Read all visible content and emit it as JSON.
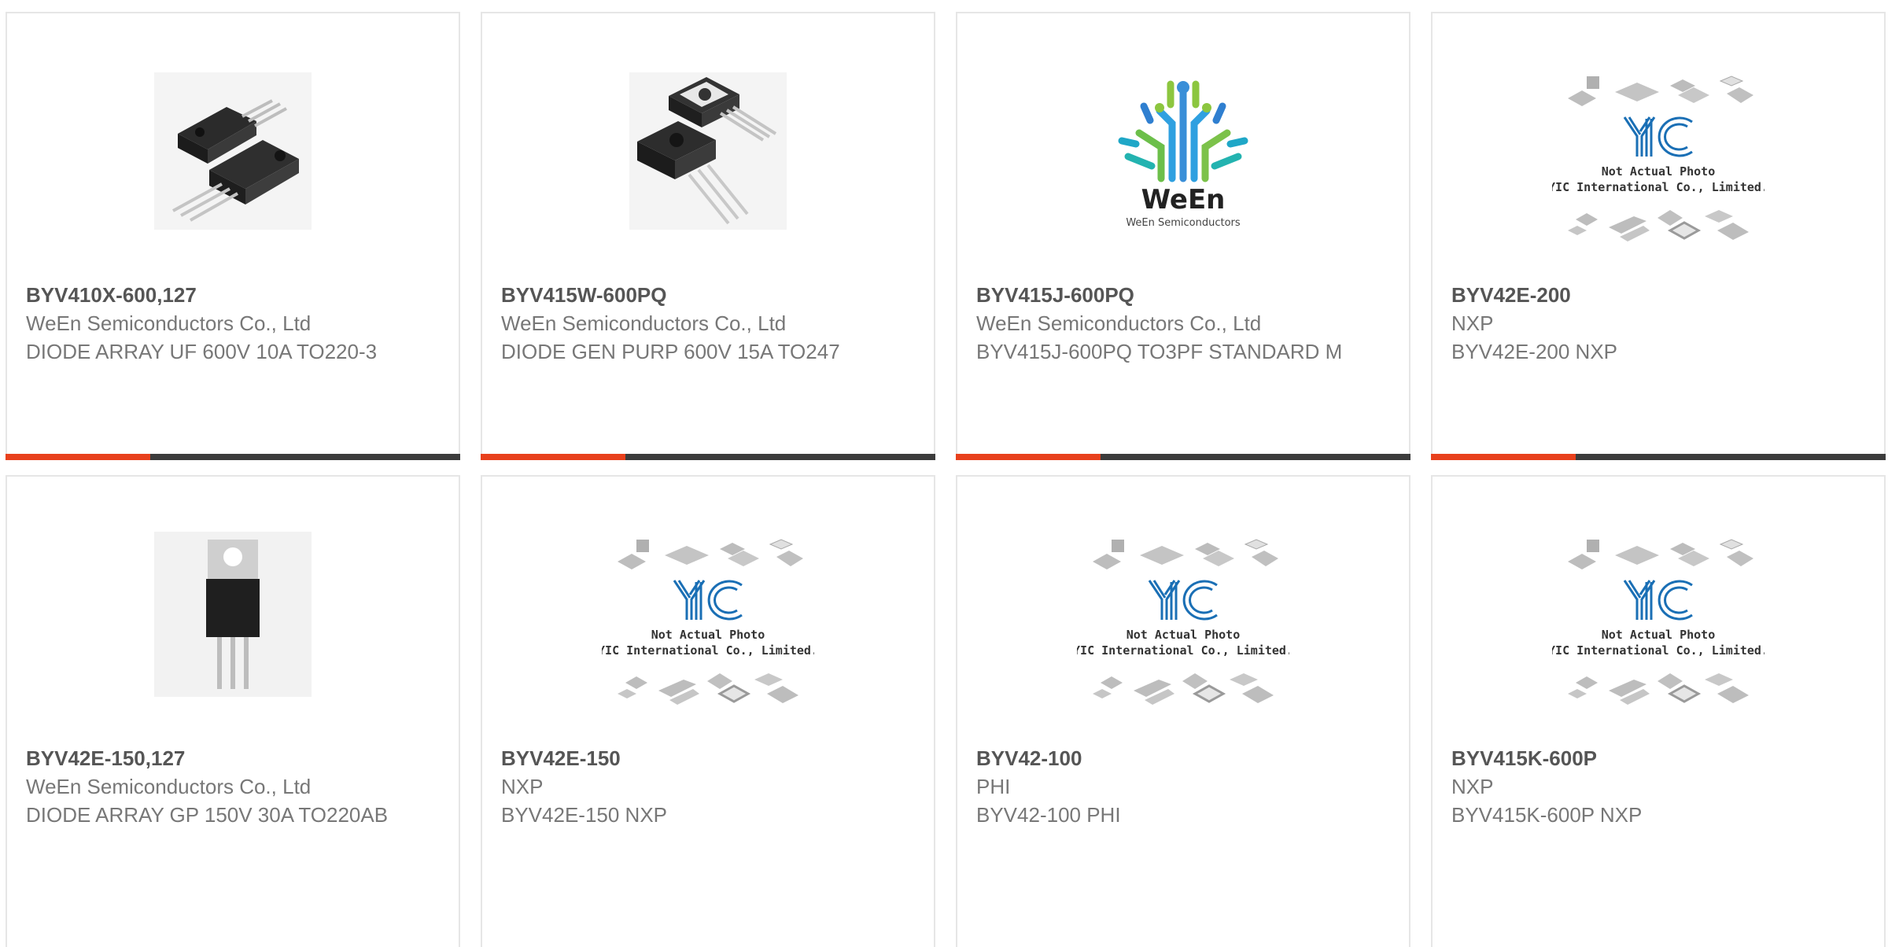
{
  "colors": {
    "accent": "#e8401c",
    "bar": "#3c3c3c",
    "border": "#e6e6e6",
    "title": "#555555",
    "text": "#777777",
    "yic_blue": "#1a6fb5"
  },
  "placeholder": {
    "line1": "Not Actual Photo",
    "line2": "YIC International Co., Limited."
  },
  "ween_logo": {
    "name": "WeEn",
    "sub": "WeEn Semiconductors"
  },
  "products": [
    {
      "part_number": "BYV410X-600,127",
      "manufacturer": "WeEn Semiconductors Co., Ltd",
      "description": "DIODE ARRAY UF 600V 10A TO220-3",
      "image": "to220f-twin-package-photo"
    },
    {
      "part_number": "BYV415W-600PQ",
      "manufacturer": "WeEn Semiconductors Co., Ltd",
      "description": "DIODE GEN PURP 600V 15A TO247",
      "image": "to247-package-photo"
    },
    {
      "part_number": "BYV415J-600PQ",
      "manufacturer": "WeEn Semiconductors Co., Ltd",
      "description": "BYV415J-600PQ TO3PF STANDARD M",
      "image": "ween-logo"
    },
    {
      "part_number": "BYV42E-200",
      "manufacturer": "NXP",
      "description": "BYV42E-200 NXP",
      "image": "yic-not-actual-photo"
    },
    {
      "part_number": "BYV42E-150,127",
      "manufacturer": "WeEn Semiconductors Co., Ltd",
      "description": "DIODE ARRAY GP 150V 30A TO220AB",
      "image": "to220-package-photo"
    },
    {
      "part_number": "BYV42E-150",
      "manufacturer": "NXP",
      "description": "BYV42E-150 NXP",
      "image": "yic-not-actual-photo"
    },
    {
      "part_number": "BYV42-100",
      "manufacturer": "PHI",
      "description": "BYV42-100 PHI",
      "image": "yic-not-actual-photo"
    },
    {
      "part_number": "BYV415K-600P",
      "manufacturer": "NXP",
      "description": "BYV415K-600P NXP",
      "image": "yic-not-actual-photo"
    }
  ]
}
